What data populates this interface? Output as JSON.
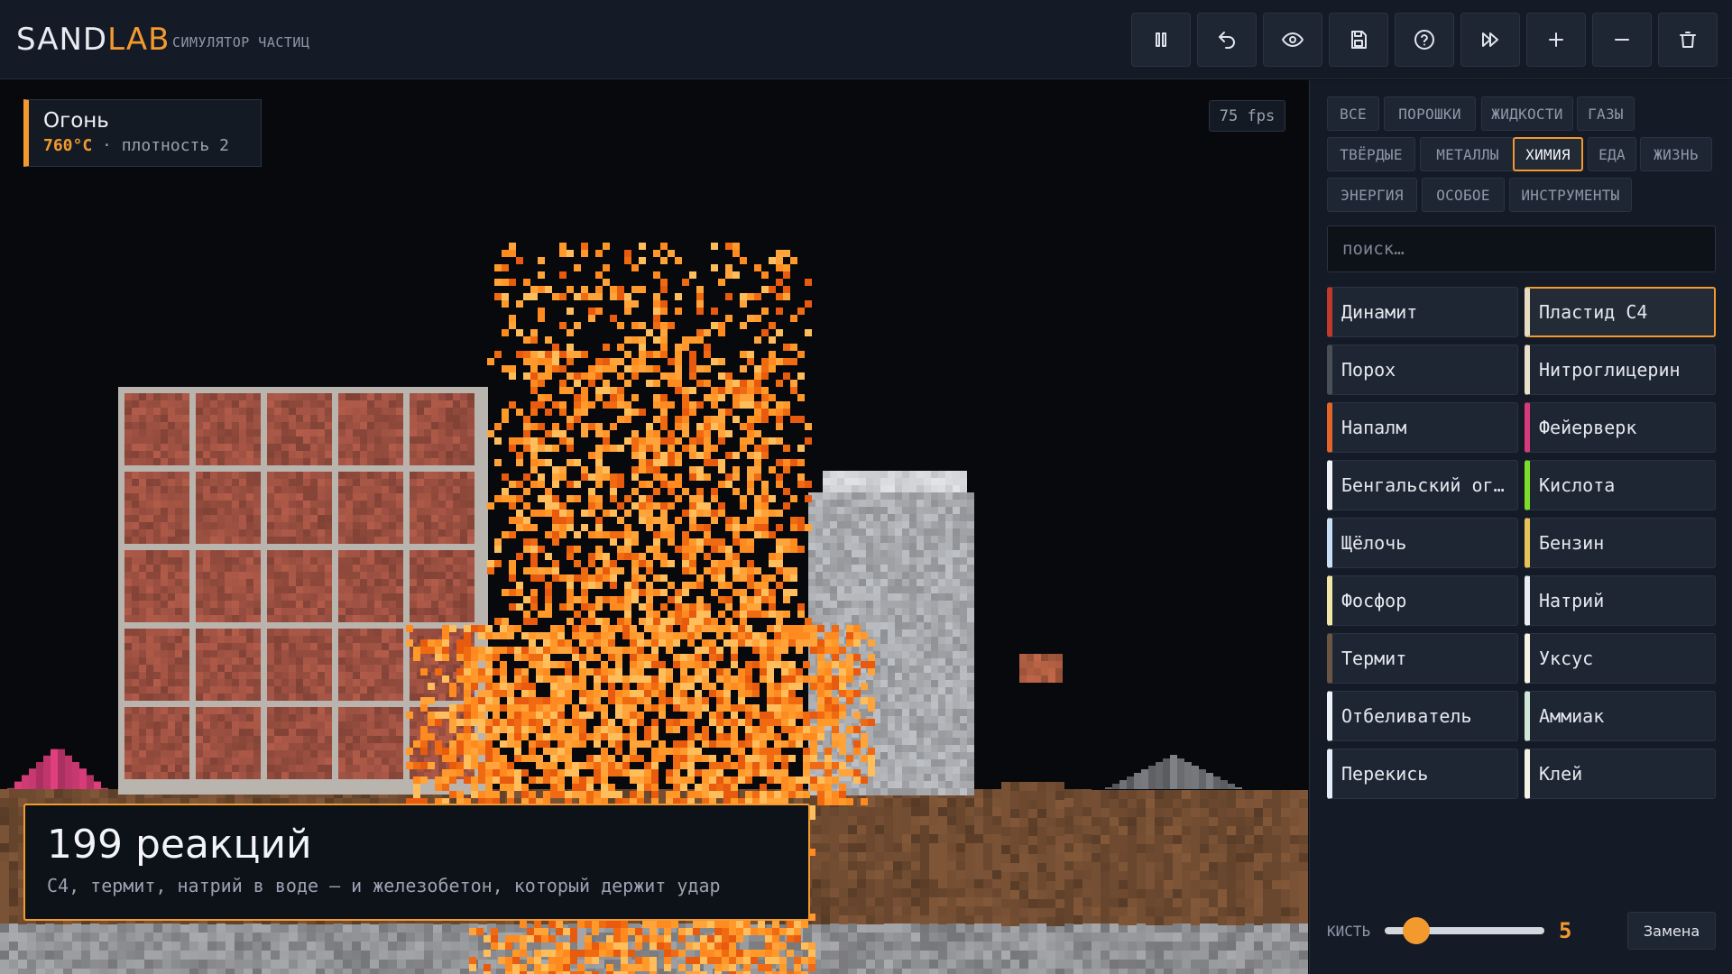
{
  "app": {
    "logo_part1": "SAND",
    "logo_part2": "LAB",
    "subtitle": "СИМУЛЯТОР ЧАСТИЦ"
  },
  "toolbar": [
    {
      "name": "pause-button",
      "icon": "pause-icon"
    },
    {
      "name": "undo-button",
      "icon": "undo-icon"
    },
    {
      "name": "view-button",
      "icon": "eye-icon"
    },
    {
      "name": "save-button",
      "icon": "save-icon"
    },
    {
      "name": "help-button",
      "icon": "help-icon"
    },
    {
      "name": "fast-forward-button",
      "icon": "fast-forward-icon"
    },
    {
      "name": "zoom-in-button",
      "icon": "plus-icon"
    },
    {
      "name": "zoom-out-button",
      "icon": "minus-icon"
    },
    {
      "name": "clear-button",
      "icon": "trash-icon"
    }
  ],
  "hover_info": {
    "name": "Огонь",
    "temperature": "760°C",
    "density_text": " · плотность 2"
  },
  "fps": "75 fps",
  "banner": {
    "title": "199 реакций",
    "text": "С4, термит, натрий в воде — и железобетон, который держит удар"
  },
  "categories": [
    {
      "label": "ВСЕ",
      "active": false
    },
    {
      "label": "ПОРОШКИ",
      "active": false
    },
    {
      "label": "ЖИДКОСТИ",
      "active": false
    },
    {
      "label": "ГАЗЫ",
      "active": false
    },
    {
      "label": "ТВЁРДЫЕ",
      "active": false
    },
    {
      "label": "МЕТАЛЛЫ",
      "active": false
    },
    {
      "label": "ХИМИЯ",
      "active": true
    },
    {
      "label": "ЕДА",
      "active": false
    },
    {
      "label": "ЖИЗНЬ",
      "active": false
    },
    {
      "label": "ЭНЕРГИЯ",
      "active": false
    },
    {
      "label": "ОСОБОЕ",
      "active": false
    },
    {
      "label": "ИНСТРУМЕНТЫ",
      "active": false
    }
  ],
  "search": {
    "placeholder": "поиск…",
    "value": ""
  },
  "elements": [
    {
      "label": "Динамит",
      "color": "#c0392b",
      "selected": false
    },
    {
      "label": "Пластид С4",
      "color": "#e7dcc2",
      "selected": true
    },
    {
      "label": "Порох",
      "color": "#4a4e57",
      "selected": false
    },
    {
      "label": "Нитроглицерин",
      "color": "#e8e0c8",
      "selected": false
    },
    {
      "label": "Напалм",
      "color": "#e3652a",
      "selected": false
    },
    {
      "label": "Фейерверк",
      "color": "#d63a7a",
      "selected": false
    },
    {
      "label": "Бенгальский огонь",
      "color": "#f0f2f5",
      "selected": false
    },
    {
      "label": "Кислота",
      "color": "#7ddc2b",
      "selected": false
    },
    {
      "label": "Щёлочь",
      "color": "#c9dff5",
      "selected": false
    },
    {
      "label": "Бензин",
      "color": "#e6c15a",
      "selected": false
    },
    {
      "label": "Фосфор",
      "color": "#f1e6a8",
      "selected": false
    },
    {
      "label": "Натрий",
      "color": "#e9edf2",
      "selected": false
    },
    {
      "label": "Термит",
      "color": "#6b5545",
      "selected": false
    },
    {
      "label": "Уксус",
      "color": "#f5f2e4",
      "selected": false
    },
    {
      "label": "Отбеливатель",
      "color": "#eef3f7",
      "selected": false
    },
    {
      "label": "Аммиак",
      "color": "#cfe6d8",
      "selected": false
    },
    {
      "label": "Перекись",
      "color": "#e3eef8",
      "selected": false
    },
    {
      "label": "Клей",
      "color": "#f4f1e6",
      "selected": false
    }
  ],
  "brush": {
    "label": "КИСТЬ",
    "value": "5",
    "level_fraction": 0.2
  },
  "mode_button": "Замена",
  "colors": {
    "accent": "#f39a2e",
    "panel": "#151b26",
    "canvas": "#08090d",
    "fire": "#ff8a1f",
    "brick": "#9a4f40",
    "concrete": "#a7a9ad",
    "dirt": "#6e4a30",
    "stone": "#8f9093"
  }
}
